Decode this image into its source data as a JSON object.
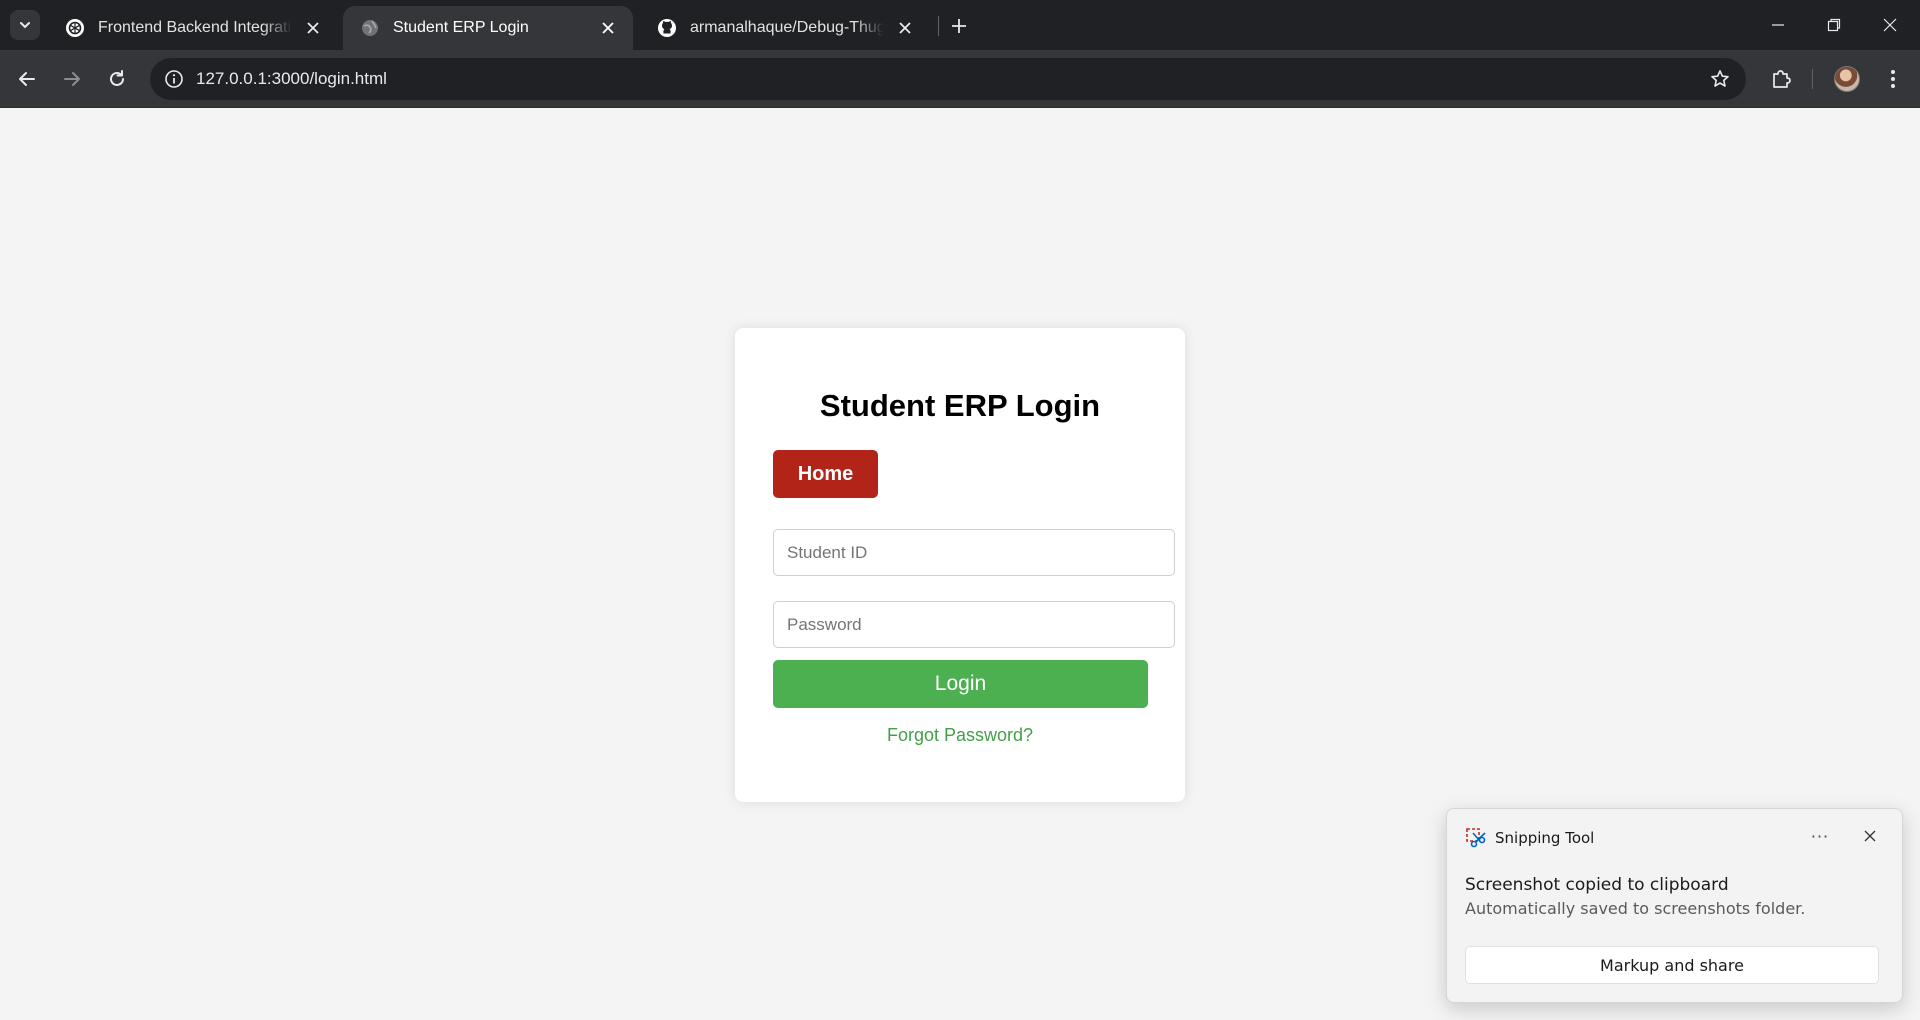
{
  "browser": {
    "tabs": [
      {
        "title": "Frontend Backend Integration C",
        "icon": "chatgpt-icon",
        "active": false
      },
      {
        "title": "Student ERP Login",
        "icon": "globe-icon",
        "active": true
      },
      {
        "title": "armanalhaque/Debug-Thugs: Th",
        "icon": "github-icon",
        "active": false
      }
    ],
    "url": "127.0.0.1:3000/login.html",
    "colors": {
      "tabstrip": "#202124",
      "toolbar": "#35363a",
      "omnibox": "#202124"
    }
  },
  "login": {
    "title": "Student ERP Login",
    "home_label": "Home",
    "student_id_placeholder": "Student ID",
    "student_id_value": "",
    "password_placeholder": "Password",
    "password_value": "",
    "login_label": "Login",
    "forgot_label": "Forgot Password?",
    "colors": {
      "home": "#b22418",
      "login": "#4caf50",
      "forgot": "#43a047",
      "card": "#ffffff",
      "page": "#f4f4f4"
    }
  },
  "toast": {
    "app_name": "Snipping Tool",
    "more_label": "···",
    "title": "Screenshot copied to clipboard",
    "body": "Automatically saved to screenshots folder.",
    "action_label": "Markup and share"
  }
}
